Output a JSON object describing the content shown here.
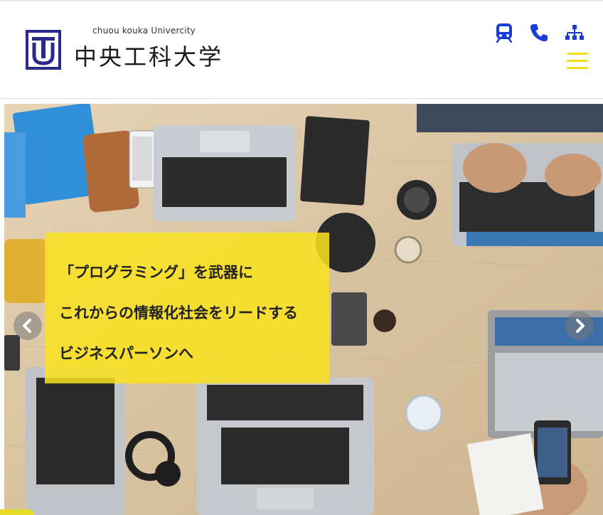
{
  "header": {
    "logo": {
      "name_en": "chuou kouka Univercity",
      "name_ja": "中央工科大学",
      "mark_letter": "TU"
    },
    "icons": [
      {
        "name": "train-icon",
        "label": "access"
      },
      {
        "name": "phone-icon",
        "label": "contact"
      },
      {
        "name": "sitemap-icon",
        "label": "sitemap"
      }
    ],
    "menu_icon": "hamburger-menu-icon"
  },
  "hero": {
    "caption_lines": [
      "「プログラミング」を武器に",
      "これからの情報化社会をリードする",
      "ビジネスパーソンへ"
    ],
    "prev_icon": "chevron-left-icon",
    "next_icon": "chevron-right-icon"
  },
  "colors": {
    "accent_yellow": "#f5dc1a",
    "caption_bg": "#fae21e",
    "brand_navy": "#2b2a8c",
    "icon_blue": "#1a3cd6"
  }
}
